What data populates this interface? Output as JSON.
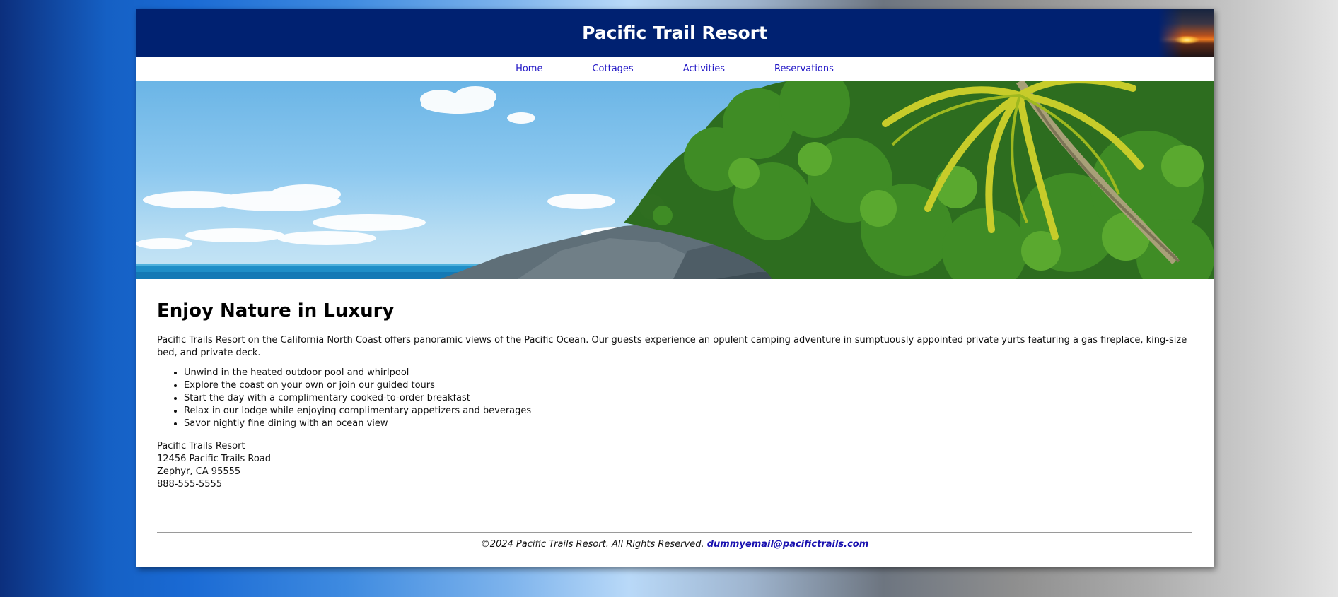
{
  "header": {
    "title": "Pacific Trail Resort",
    "logo_icon": "sunset-image"
  },
  "nav": {
    "items": [
      {
        "label": "Home"
      },
      {
        "label": "Cottages"
      },
      {
        "label": "Activities"
      },
      {
        "label": "Reservations"
      }
    ],
    "link_color": "#2217c6"
  },
  "hero": {
    "image": "tropical-coast-photo"
  },
  "main": {
    "heading": "Enjoy Nature in Luxury",
    "intro": "Pacific Trails Resort on the California North Coast offers panoramic views of the Pacific Ocean. Our guests experience an opulent camping adventure in sumptuously appointed private yurts featuring a gas fireplace, king-size bed, and private deck.",
    "features": [
      "Unwind in the heated outdoor pool and whirlpool",
      "Explore the coast on your own or join our guided tours",
      "Start the day with a complimentary cooked-to-order breakfast",
      "Relax in our lodge while enjoying complimentary appetizers and beverages",
      "Savor nightly fine dining with an ocean view"
    ],
    "contact": {
      "name": "Pacific Trails Resort",
      "street": "12456 Pacific Trails Road",
      "city": "Zephyr, CA 95555",
      "phone": "888-555-5555"
    }
  },
  "footer": {
    "copyright": "©2024 Pacific Trails Resort. All Rights Reserved.",
    "email": "dummyemail@pacifictrails.com"
  },
  "colors": {
    "header_bg": "#002171",
    "page_bg": "#ffffff"
  }
}
